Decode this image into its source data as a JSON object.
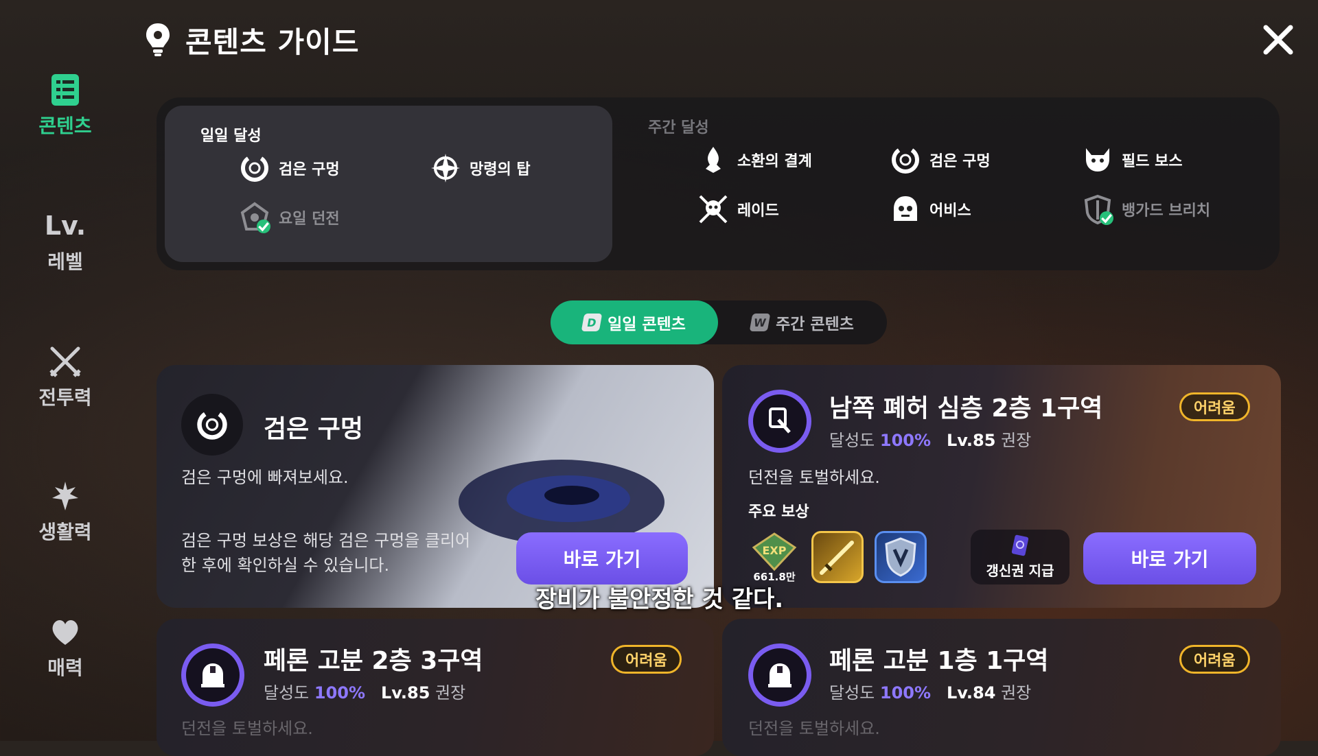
{
  "header": {
    "title": "콘텐츠 가이드"
  },
  "sidebar": {
    "items": [
      {
        "label": "콘텐츠",
        "active": true
      },
      {
        "label": "레벨",
        "icon_text": "Lv."
      },
      {
        "label": "전투력"
      },
      {
        "label": "생활력"
      },
      {
        "label": "매력"
      }
    ]
  },
  "achievement": {
    "daily_label": "일일 달성",
    "weekly_label": "주간 달성",
    "daily_items": [
      {
        "label": "검은 구멍",
        "done": false
      },
      {
        "label": "망령의 탑",
        "done": false
      },
      {
        "label": "요일 던전",
        "done": true
      }
    ],
    "weekly_items": [
      {
        "label": "소환의 결계",
        "done": false
      },
      {
        "label": "검은 구멍",
        "done": false
      },
      {
        "label": "필드 보스",
        "done": false
      },
      {
        "label": "레이드",
        "done": false
      },
      {
        "label": "어비스",
        "done": false
      },
      {
        "label": "뱅가드 브리치",
        "done": true
      }
    ]
  },
  "tabs": [
    {
      "label": "일일 콘텐츠",
      "badge": "D",
      "active": true
    },
    {
      "label": "주간 콘텐츠",
      "badge": "W",
      "active": false
    }
  ],
  "cards": {
    "black_hole": {
      "title": "검은 구멍",
      "desc": "검은 구멍에 빠져보세요.",
      "note_line1": "검은 구멍 보상은 해당 검은 구멍을 클리어",
      "note_line2": "한 후에 확인하실 수 있습니다.",
      "button": "바로 가기"
    },
    "south_ruins": {
      "title": "남쪽 폐허 심층 2층 1구역",
      "badge": "어려움",
      "progress_label": "달성도",
      "progress": "100%",
      "level": "Lv.85",
      "level_suffix": "권장",
      "desc": "던전을 토벌하세요.",
      "reward_label": "주요 보상",
      "exp_amount": "661.8만",
      "ticket_label": "갱신권 지급",
      "button": "바로 가기"
    },
    "peron_2_3": {
      "title": "페론 고분 2층 3구역",
      "badge": "어려움",
      "progress_label": "달성도",
      "progress": "100%",
      "level": "Lv.85",
      "level_suffix": "권장",
      "desc": "던전을 토벌하세요."
    },
    "peron_1_1": {
      "title": "페론 고분 1층 1구역",
      "badge": "어려움",
      "progress_label": "달성도",
      "progress": "100%",
      "level": "Lv.84",
      "level_suffix": "권장",
      "desc": "던전을 토벌하세요."
    }
  },
  "subtitle": "장비가 불안정한 것 같다.",
  "colors": {
    "accent_green": "#19b47b",
    "accent_purple": "#7a5cf0",
    "badge_gold": "#f0b52a"
  }
}
